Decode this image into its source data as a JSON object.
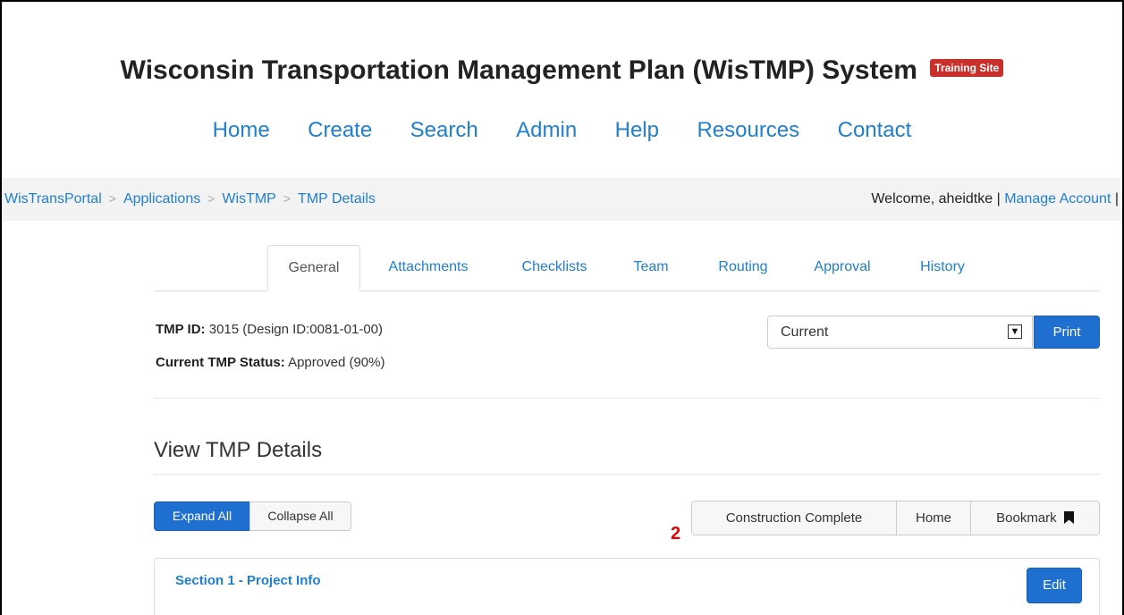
{
  "header": {
    "title": "Wisconsin Transportation Management Plan (WisTMP) System",
    "badge": "Training Site"
  },
  "nav": {
    "items": [
      "Home",
      "Create",
      "Search",
      "Admin",
      "Help",
      "Resources",
      "Contact"
    ]
  },
  "breadcrumb": {
    "items": [
      "WisTransPortal",
      "Applications",
      "WisTMP",
      "TMP Details"
    ],
    "separator": ">"
  },
  "account": {
    "welcome": "Welcome, aheidtke |",
    "manage": "Manage Account",
    "trail": "|"
  },
  "tabs": {
    "items": [
      "General",
      "Attachments",
      "Checklists",
      "Team",
      "Routing",
      "Approval",
      "History"
    ],
    "active": "General"
  },
  "info": {
    "tmp_id_label": "TMP ID:",
    "tmp_id_value": "3015 (Design ID:0081-01-00)",
    "status_label": "Current TMP Status:",
    "status_value": "Approved (90%)"
  },
  "version_select": {
    "value": "Current",
    "arrow": "▼"
  },
  "print_label": "Print",
  "section_heading": "View TMP Details",
  "toolbar": {
    "expand_all": "Expand All",
    "collapse_all": "Collapse All",
    "construction_complete": "Construction Complete",
    "home": "Home",
    "bookmark": "Bookmark",
    "bookmark_icon": "bookmark-icon"
  },
  "annotation_number": "2",
  "panel": {
    "title": "Section 1 - Project Info",
    "edit_label": "Edit"
  },
  "colors": {
    "link": "#1f7fd0",
    "primary": "#1f6fd0",
    "badge": "#c9302c",
    "annotation": "#ee0000"
  }
}
